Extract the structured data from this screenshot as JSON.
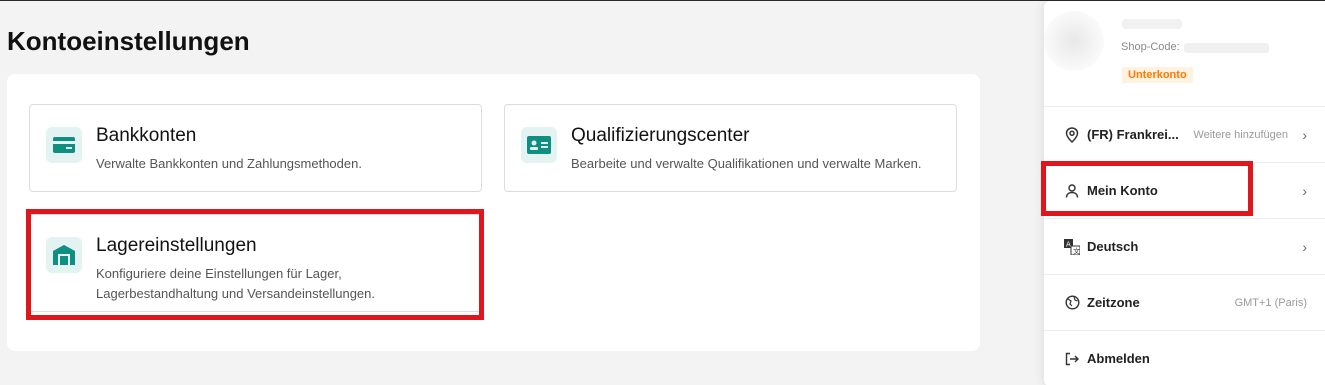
{
  "page": {
    "title": "Kontoeinstellungen"
  },
  "cards": [
    {
      "title": "Bankkonten",
      "desc": "Verwalte Bankkonten und Zahlungsmethoden."
    },
    {
      "title": "Qualifizierungscenter",
      "desc": "Bearbeite und verwalte Qualifikationen und verwalte Marken."
    },
    {
      "title": "Lagereinstellungen",
      "desc": "Konfiguriere deine Einstellungen für Lager, Lagerbestandhaltung und Versandeinstellungen."
    }
  ],
  "account_menu": {
    "shop_code_label": "Shop-Code:",
    "badge": "Unterkonto",
    "items": [
      {
        "label": "(FR) Frankrei...",
        "sub": "Weitere hinzufügen",
        "icon": "location-pin-icon"
      },
      {
        "label": "Mein Konto",
        "sub": "",
        "icon": "person-icon"
      },
      {
        "label": "Deutsch",
        "sub": "",
        "icon": "translate-icon"
      },
      {
        "label": "Zeitzone",
        "sub": "GMT+1 (Paris)",
        "icon": "globe-icon"
      },
      {
        "label": "Abmelden",
        "sub": "",
        "icon": "logout-icon"
      }
    ]
  },
  "colors": {
    "accent_teal": "#0e8f82",
    "highlight_red": "#e0161d",
    "badge_orange": "#ff7a00"
  }
}
